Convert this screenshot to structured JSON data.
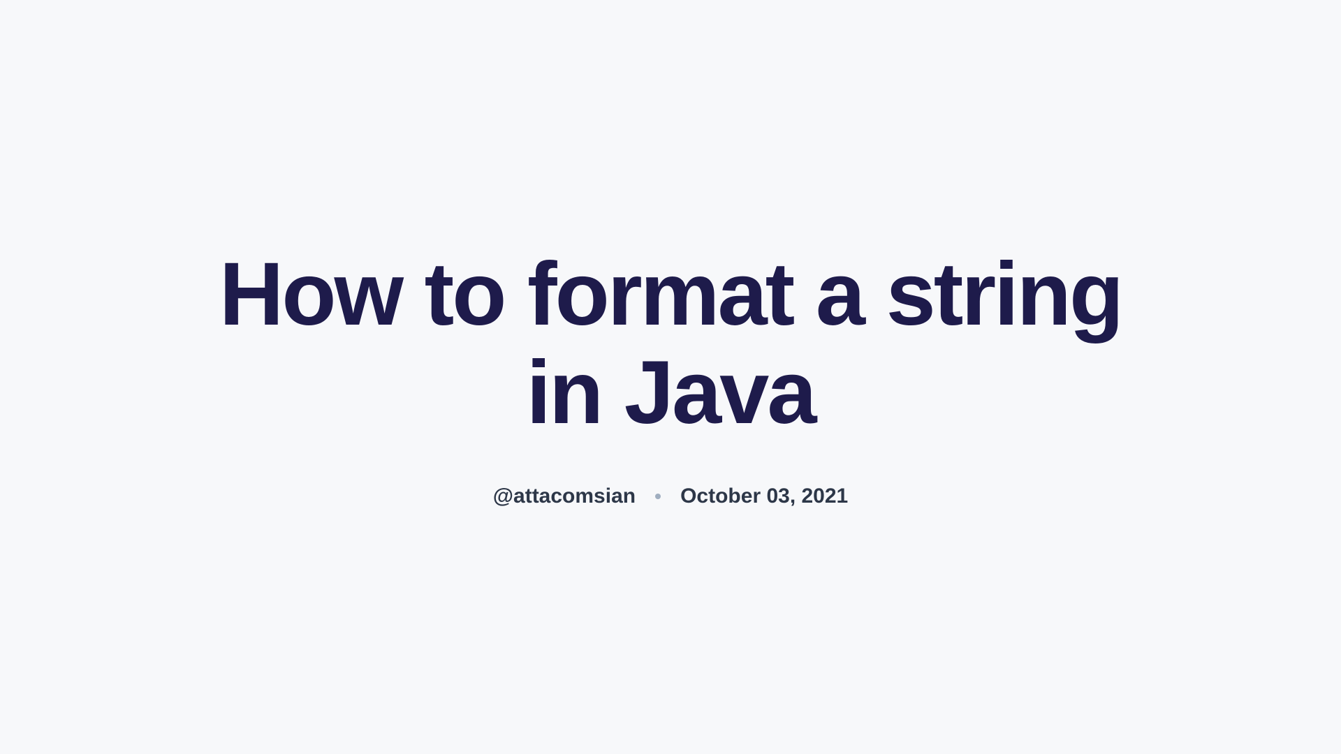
{
  "article": {
    "title": "How to format a string in Java",
    "author_handle": "@attacomsian",
    "date": "October 03, 2021"
  }
}
